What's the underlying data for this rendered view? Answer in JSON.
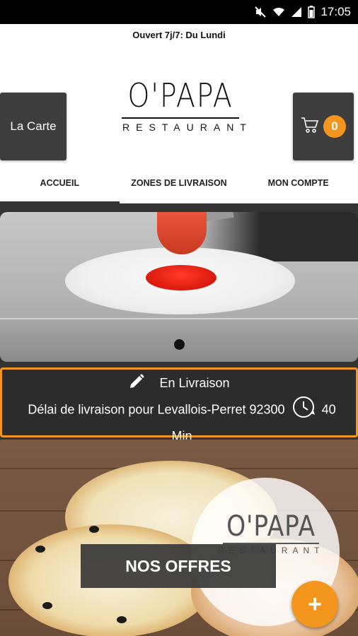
{
  "status_bar": {
    "time": "17:05",
    "icons": [
      "mute-icon",
      "wifi-icon",
      "signal-icon",
      "battery-icon"
    ]
  },
  "ticker": {
    "text": "Ouvert 7j/7: Du Lundi"
  },
  "header": {
    "menu_button_label": "La Carte",
    "logo_main": "O'PAPA",
    "logo_sub": "RESTAURANT",
    "cart_count": "0"
  },
  "tabs": [
    {
      "label": "ACCUEIL",
      "active": true
    },
    {
      "label": "ZONES DE LIVRAISON",
      "active": false
    },
    {
      "label": "MON COMPTE",
      "active": false
    }
  ],
  "slider": {
    "image": "pizza-dough-with-tomato-sauce",
    "page_indicator_count": 1
  },
  "delivery": {
    "mode_label": "En Livraison",
    "delay_text": "Délai de livraison pour Levallois-Perret 92300",
    "delay_value": "40",
    "delay_unit": "Min"
  },
  "promo": {
    "button_label": "NOS OFFRES",
    "badge_logo_main": "O'PAPA",
    "badge_logo_sub": "RESTAURANT"
  },
  "colors": {
    "accent": "#f4961e",
    "dark_button": "#3d3d3d",
    "background_dark": "#333333"
  }
}
